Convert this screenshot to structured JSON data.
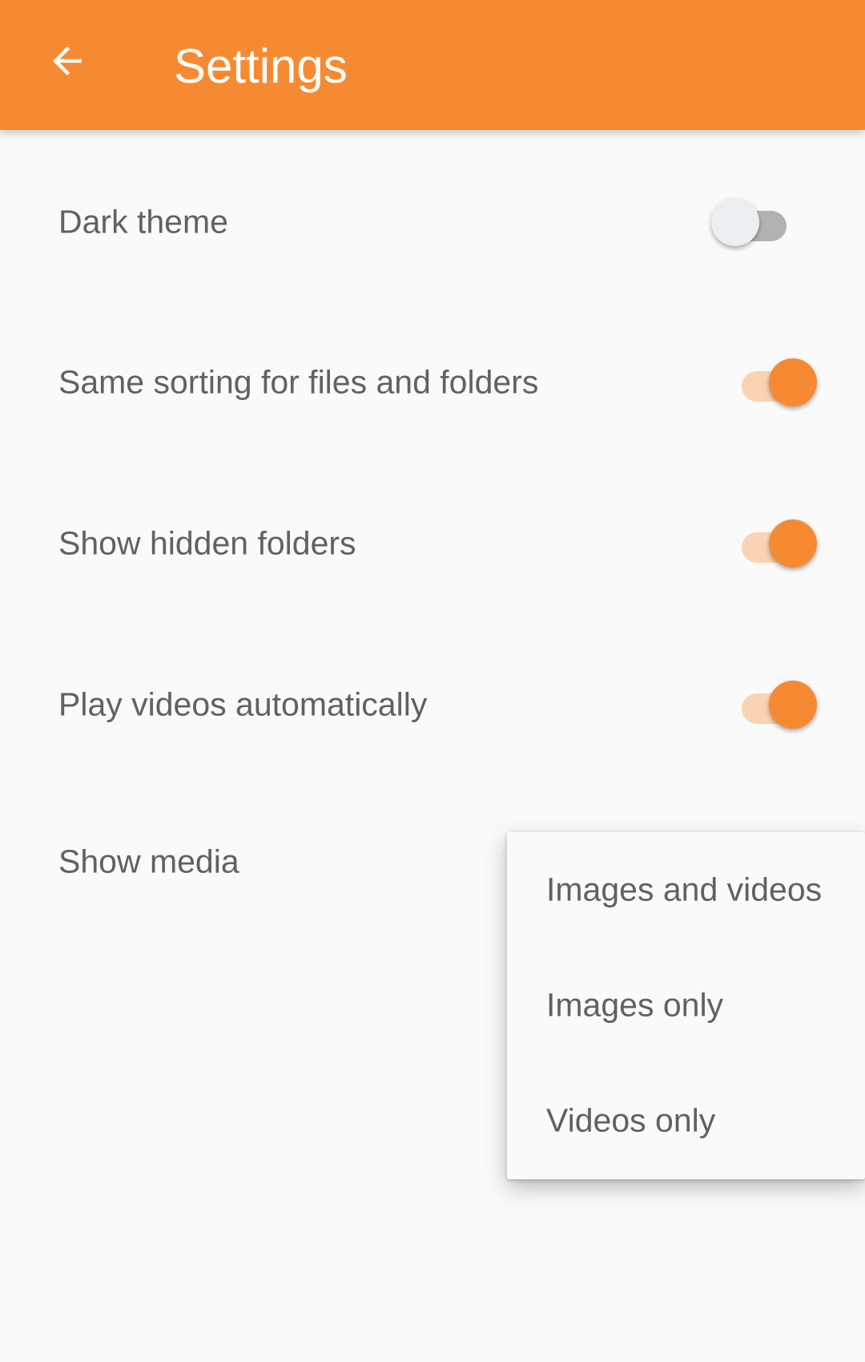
{
  "app_bar": {
    "title": "Settings",
    "back_icon": "arrow-back-icon",
    "color": "#f68a33"
  },
  "settings": [
    {
      "label": "Dark theme",
      "enabled": false
    },
    {
      "label": "Same sorting for files and folders",
      "enabled": true
    },
    {
      "label": "Show hidden folders",
      "enabled": true
    },
    {
      "label": "Play videos automatically",
      "enabled": true
    },
    {
      "label": "Show media"
    }
  ],
  "show_media_menu": {
    "options": [
      "Images and videos",
      "Images only",
      "Videos only"
    ]
  },
  "colors": {
    "accent": "#f68a33",
    "text": "#616161",
    "background": "#fafafa"
  }
}
